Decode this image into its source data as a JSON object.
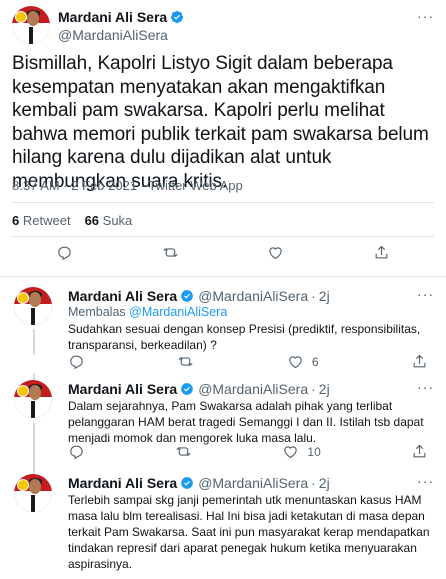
{
  "main": {
    "display_name": "Mardani Ali Sera",
    "handle": "@MardaniAliSera",
    "text": "Bismillah, Kapolri Listyo Sigit dalam beberapa kesempatan menyatakan akan mengaktifkan kembali pam swakarsa. Kapolri perlu melihat bahwa memori publik terkait pam swakarsa belum hilang karena dulu dijadikan alat untuk membungkan suara kritis.",
    "timestamp": "8.37 AM · 2 Feb 2021 · Twitter Web App",
    "retweets": "6",
    "retweets_label": "Retweet",
    "likes": "66",
    "likes_label": "Suka"
  },
  "replies": [
    {
      "display_name": "Mardani Ali Sera",
      "handle": "@MardaniAliSera",
      "sep": "·",
      "age": "2j",
      "replying_label": "Membalas",
      "replying_to": "@MardaniAliSera",
      "text": "Sudahkan sesuai dengan konsep Presisi (prediktif, responsibilitas, transparansi, berkeadilan) ?",
      "retweet_count": "",
      "like_count": "6"
    },
    {
      "display_name": "Mardani Ali Sera",
      "handle": "@MardaniAliSera",
      "sep": "·",
      "age": "2j",
      "text": "Dalam sejarahnya, Pam Swakarsa adalah pihak yang terlibat pelanggaran HAM berat tragedi Semanggi I dan II. Istilah tsb dapat menjadi momok dan mengorek luka masa lalu.",
      "retweet_count": "",
      "like_count": "10"
    },
    {
      "display_name": "Mardani Ali Sera",
      "handle": "@MardaniAliSera",
      "sep": "·",
      "age": "2j",
      "text": "Terlebih sampai skg janji pemerintah utk menuntaskan kasus HAM masa lalu blm terealisasi. Hal Ini bisa jadi ketakutan di masa depan terkait Pam Swakarsa. Saat ini pun masyarakat kerap mendapatkan tindakan represif dari aparat penegak hukum ketika menyuarakan aspirasinya.",
      "retweet_count": "",
      "like_count": ""
    }
  ],
  "icons": {
    "verified": "verified-badge-icon",
    "reply": "reply-icon",
    "retweet": "retweet-icon",
    "like": "heart-icon",
    "share": "share-icon",
    "more": "more-icon"
  },
  "colors": {
    "accent": "#1d9bf0",
    "text": "#0f1419",
    "muted": "#536471",
    "avatar_bg": "#c41d1d"
  }
}
